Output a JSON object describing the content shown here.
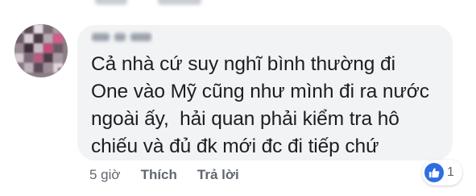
{
  "comment": {
    "lines": [
      "Cả nhà cứ suy nghĩ bình thường đi",
      "One vào Mỹ cũng như mình đi ra nước",
      "ngoài ấy,  hải quan phải kiểm tra hô",
      "chiếu và đủ đk mới đc đi tiếp chứ"
    ]
  },
  "actions": {
    "time": "5 giờ",
    "like_label": "Thích",
    "reply_label": "Trả lời"
  },
  "reaction": {
    "icon": "thumbs-up-icon",
    "count": "1",
    "color": "#2f6de2"
  },
  "colors": {
    "bubble": "#f2f3f5",
    "text": "#1c1e21",
    "meta": "#606770"
  }
}
